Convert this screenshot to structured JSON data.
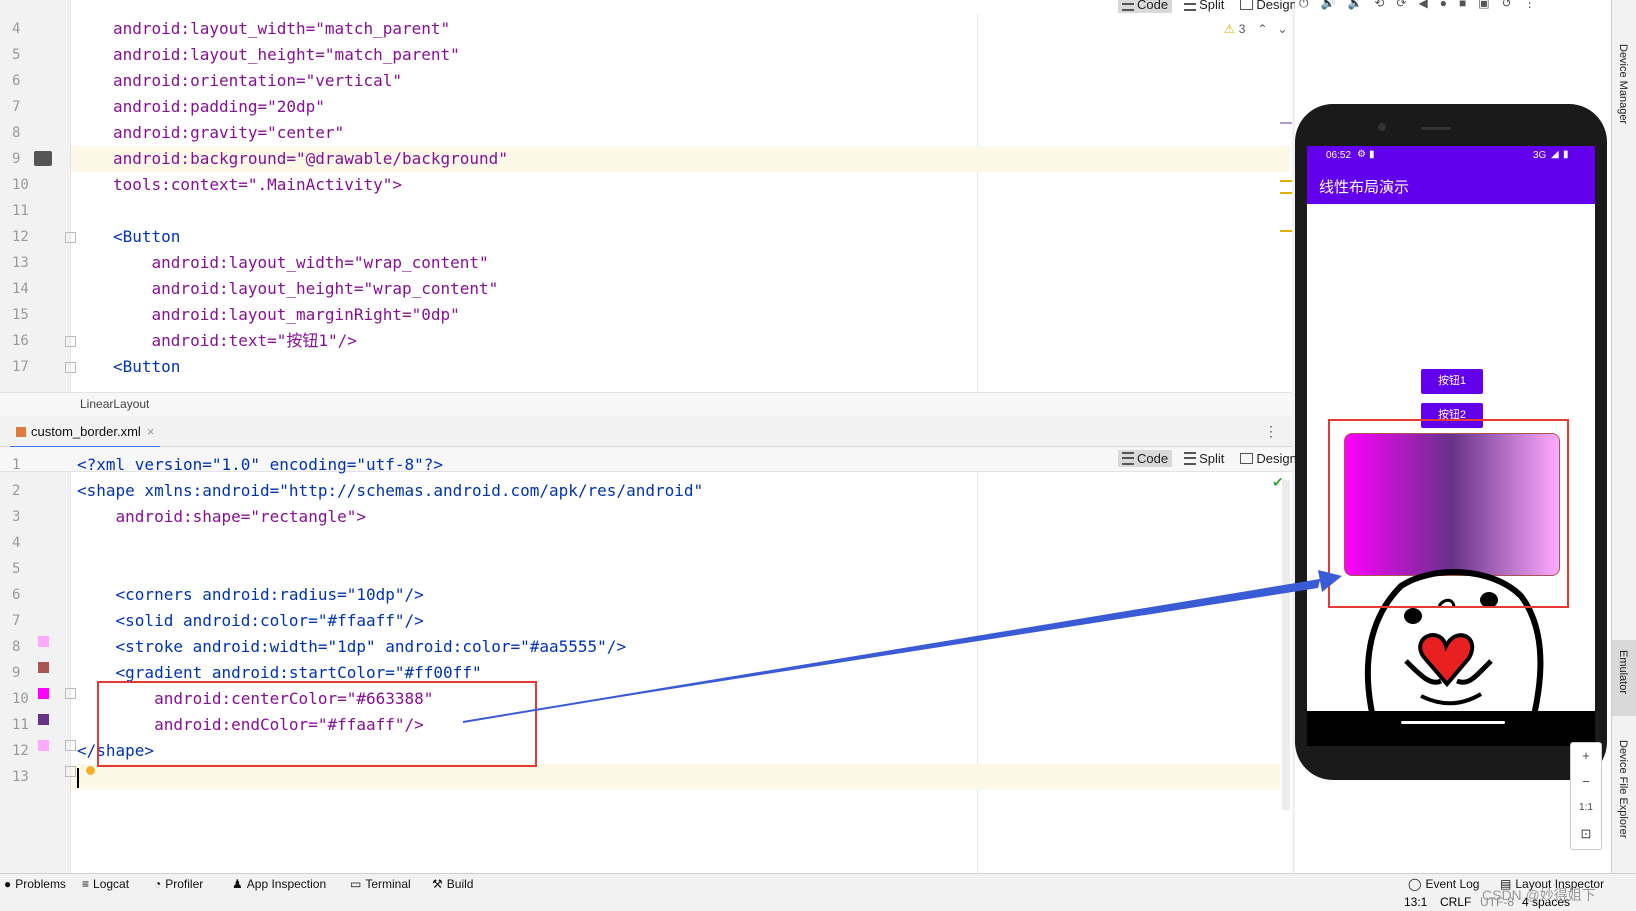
{
  "colors": {
    "accent": "#6200ee",
    "red_box": "#e53935",
    "arrow": "#3a5bd6",
    "gradient_start": "#ff00ff",
    "gradient_center": "#663388",
    "gradient_end": "#ffaaff",
    "stroke_color": "#aa5555"
  },
  "top_editor": {
    "modes": [
      "Code",
      "Split",
      "Design"
    ],
    "warning_count": "3",
    "breadcrumb": "LinearLayout",
    "lines": [
      {
        "n": "4",
        "t": "android:layout_width=\"match_parent\""
      },
      {
        "n": "5",
        "t": "android:layout_height=\"match_parent\""
      },
      {
        "n": "6",
        "t": "android:orientation=\"vertical\""
      },
      {
        "n": "7",
        "t": "android:padding=\"20dp\""
      },
      {
        "n": "8",
        "t": "android:gravity=\"center\""
      },
      {
        "n": "9",
        "t": "android:background=\"@drawable/background\""
      },
      {
        "n": "10",
        "t": "tools:context=\".MainActivity\">"
      },
      {
        "n": "11",
        "t": ""
      },
      {
        "n": "12",
        "t": "<Button"
      },
      {
        "n": "13",
        "t": "    android:layout_width=\"wrap_content\""
      },
      {
        "n": "14",
        "t": "    android:layout_height=\"wrap_content\""
      },
      {
        "n": "15",
        "t": "    android:layout_marginRight=\"0dp\""
      },
      {
        "n": "16",
        "t": "    android:text=\"按钮1\"/>"
      },
      {
        "n": "17",
        "t": "<Button"
      }
    ]
  },
  "bottom_editor": {
    "file_tab": "custom_border.xml",
    "modes": [
      "Code",
      "Split",
      "Design"
    ],
    "lines": [
      {
        "n": "1",
        "t": "<?xml version=\"1.0\" encoding=\"utf-8\"?>"
      },
      {
        "n": "2",
        "t": "<shape xmlns:android=\"http://schemas.android.com/apk/res/android\""
      },
      {
        "n": "3",
        "t": "    android:shape=\"rectangle\">"
      },
      {
        "n": "4",
        "t": ""
      },
      {
        "n": "5",
        "t": ""
      },
      {
        "n": "6",
        "t": "    <corners android:radius=\"10dp\"/>"
      },
      {
        "n": "7",
        "t": "    <solid android:color=\"#ffaaff\"/>"
      },
      {
        "n": "8",
        "t": "    <stroke android:width=\"1dp\" android:color=\"#aa5555\"/>"
      },
      {
        "n": "9",
        "t": "    <gradient android:startColor=\"#ff00ff\""
      },
      {
        "n": "10",
        "t": "        android:centerColor=\"#663388\""
      },
      {
        "n": "11",
        "t": "        android:endColor=\"#ffaaff\"/>"
      },
      {
        "n": "12",
        "t": "</shape>"
      },
      {
        "n": "13",
        "t": ""
      }
    ]
  },
  "emulator": {
    "time": "06:52",
    "network": "3G",
    "app_title": "线性布局演示",
    "button1": "按钮1",
    "button2": "按钮2",
    "zoom_plus": "+",
    "zoom_minus": "−",
    "zoom_ratio": "1:1"
  },
  "right_rail": {
    "device_manager": "Device Manager",
    "emulator": "Emulator",
    "device_file_explorer": "Device File Explorer"
  },
  "tool_windows": [
    "Problems",
    "Logcat",
    "Profiler",
    "App Inspection",
    "Terminal",
    "Build"
  ],
  "right_tools": [
    "Event Log",
    "Layout Inspector"
  ],
  "status": {
    "position": "13:1",
    "line_sep": "CRLF",
    "encoding": "UTF-8",
    "indent": "4 spaces",
    "watermark": "CSDN @妙得姐下"
  }
}
